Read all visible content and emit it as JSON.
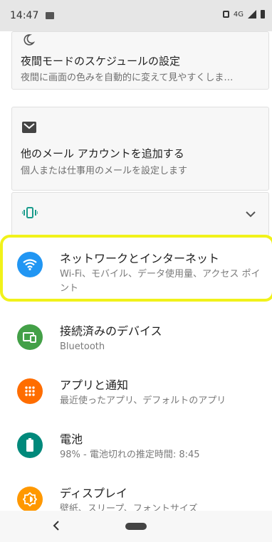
{
  "status": {
    "time": "14:47",
    "network": "4G"
  },
  "cards": [
    {
      "title": "夜間モードのスケジュールの設定",
      "subtitle": "夜間に画面の色みを自動的に変えて見やすくしま…"
    },
    {
      "title": "他のメール アカウントを追加する",
      "subtitle": "個人または仕事用のメールを設定します"
    }
  ],
  "items": [
    {
      "title": "ネットワークとインターネット",
      "subtitle": "Wi-Fi、モバイル、データ使用量、アクセス ポイント",
      "icon": "wifi-icon",
      "color": "#2196f3"
    },
    {
      "title": "接続済みのデバイス",
      "subtitle": "Bluetooth",
      "icon": "devices-icon",
      "color": "#43a047"
    },
    {
      "title": "アプリと通知",
      "subtitle": "最近使ったアプリ、デフォルトのアプリ",
      "icon": "apps-icon",
      "color": "#ff6d00"
    },
    {
      "title": "電池",
      "subtitle": "98% - 電池切れの推定時間: 8:45",
      "icon": "battery-icon",
      "color": "#00897b"
    },
    {
      "title": "ディスプレイ",
      "subtitle": "壁紙、スリープ、フォントサイズ",
      "icon": "display-icon",
      "color": "#ff9800"
    }
  ]
}
